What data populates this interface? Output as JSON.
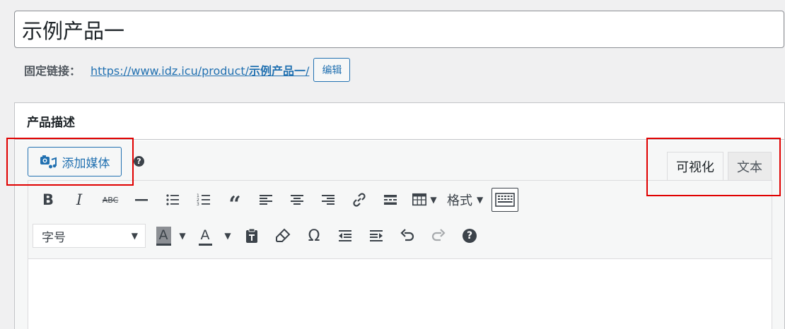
{
  "title": {
    "value": "示例产品一"
  },
  "permalink": {
    "label": "固定链接：",
    "url_prefix": "https://www.idz.icu/product/",
    "slug": "示例产品一",
    "url_suffix": "/",
    "edit_label": "编辑"
  },
  "postbox": {
    "heading": "产品描述",
    "add_media_label": "添加媒体",
    "help_label": "?",
    "tabs": [
      {
        "label": "可视化",
        "active": true
      },
      {
        "label": "文本",
        "active": false
      }
    ]
  },
  "toolbar": {
    "row1": [
      "bold-icon",
      "italic-icon",
      "strikethrough-icon",
      "horizontal-line-icon",
      "bullet-list-icon",
      "numbered-list-icon",
      "blockquote-icon",
      "align-left-icon",
      "align-center-icon",
      "align-right-icon",
      "link-icon",
      "read-more-icon",
      "table-icon"
    ],
    "format_label": "格式",
    "strike_text": "ABC",
    "font_size_placeholder": "字号",
    "text_color_letter": "A",
    "bg_color_letter": "A",
    "omega": "Ω",
    "help": "?"
  },
  "colors": {
    "accent": "#2271b1",
    "highlight": "#e00000",
    "text": "#1d2327"
  }
}
